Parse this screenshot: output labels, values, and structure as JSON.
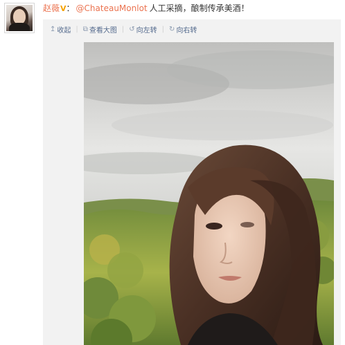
{
  "post": {
    "author": "赵薇",
    "vip_badge": "V",
    "mention": "@ChateauMonlot",
    "content": "人工采摘，酿制传承美酒！"
  },
  "toolbar": {
    "collapse": {
      "icon": "arrow-up-icon",
      "label": "收起"
    },
    "view_large": {
      "icon": "enlarge-icon",
      "label": "查看大图"
    },
    "rotate_left": {
      "icon": "rotate-left-icon",
      "label": "向左转"
    },
    "rotate_right": {
      "icon": "rotate-right-icon",
      "label": "向右转"
    }
  },
  "colors": {
    "author": "#eb7350",
    "toolbar_link": "#556b8e",
    "card_bg": "#f2f2f2"
  }
}
